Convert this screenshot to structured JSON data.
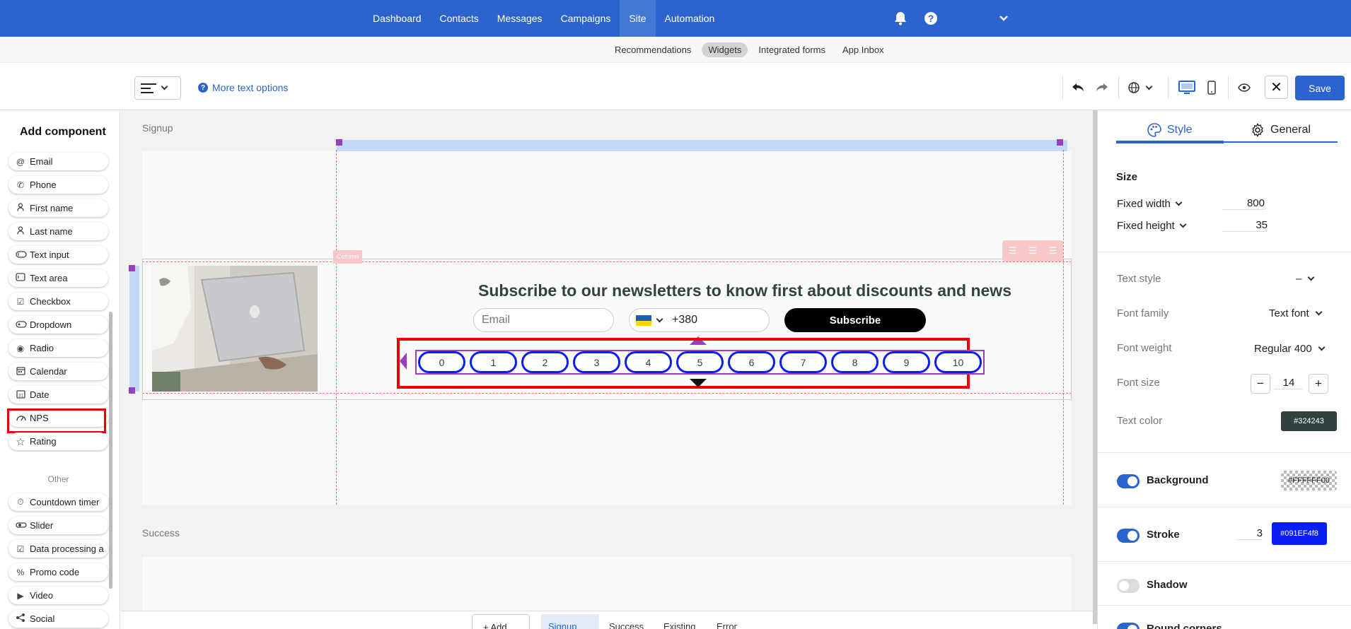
{
  "topnav": {
    "items": [
      "Dashboard",
      "Contacts",
      "Messages",
      "Campaigns",
      "Site",
      "Automation"
    ],
    "active": "Site"
  },
  "subtabs": {
    "items": [
      "Recommendations",
      "Widgets",
      "Integrated forms",
      "App Inbox"
    ],
    "active": "Widgets"
  },
  "toolbar": {
    "more_text_options": "More text options",
    "save_label": "Save"
  },
  "left_panel": {
    "title": "Add component",
    "components": [
      {
        "label": "Email",
        "icon": "at-icon"
      },
      {
        "label": "Phone",
        "icon": "phone-icon"
      },
      {
        "label": "First name",
        "icon": "person-icon"
      },
      {
        "label": "Last name",
        "icon": "person-icon"
      },
      {
        "label": "Text input",
        "icon": "text-input-icon"
      },
      {
        "label": "Text area",
        "icon": "text-area-icon"
      },
      {
        "label": "Checkbox",
        "icon": "checkbox-icon"
      },
      {
        "label": "Dropdown",
        "icon": "dropdown-icon"
      },
      {
        "label": "Radio",
        "icon": "radio-icon"
      },
      {
        "label": "Calendar",
        "icon": "calendar-icon"
      },
      {
        "label": "Date",
        "icon": "date-icon"
      },
      {
        "label": "NPS",
        "icon": "gauge-icon"
      },
      {
        "label": "Rating",
        "icon": "star-icon"
      }
    ],
    "other_heading": "Other",
    "other_components": [
      {
        "label": "Countdown timer",
        "icon": "timer-icon"
      },
      {
        "label": "Slider",
        "icon": "slider-icon"
      },
      {
        "label": "Data processing a",
        "icon": "checkbox-icon"
      },
      {
        "label": "Promo code",
        "icon": "percent-icon"
      },
      {
        "label": "Video",
        "icon": "play-icon"
      },
      {
        "label": "Social",
        "icon": "share-icon"
      }
    ]
  },
  "canvas": {
    "signup_label": "Signup",
    "success_label": "Success",
    "column_tag": "Column",
    "headline": "Subscribe to our newsletters to know first about discounts and news",
    "email_placeholder": "Email",
    "phone_code": "+380",
    "subscribe_label": "Subscribe",
    "nps_values": [
      "0",
      "1",
      "2",
      "3",
      "4",
      "5",
      "6",
      "7",
      "8",
      "9",
      "10"
    ],
    "bottom_tabs": {
      "add": "+ Add",
      "items": [
        "Signup",
        "Success",
        "Existing",
        "Error"
      ]
    }
  },
  "right_panel": {
    "tabs": [
      "Style",
      "General"
    ],
    "active_tab": "Style",
    "size_heading": "Size",
    "fixed_width_label": "Fixed width",
    "fixed_width_value": "800",
    "fixed_height_label": "Fixed height",
    "fixed_height_value": "35",
    "text_style_label": "Text style",
    "text_style_value": "–",
    "font_family_label": "Font family",
    "font_family_value": "Text font",
    "font_weight_label": "Font weight",
    "font_weight_value": "Regular 400",
    "font_size_label": "Font size",
    "font_size_value": "14",
    "text_color_label": "Text color",
    "text_color_value": "#324243",
    "background_label": "Background",
    "background_value": "#FFFFFF00",
    "stroke_label": "Stroke",
    "stroke_width": "3",
    "stroke_color": "#091EF4f8",
    "shadow_label": "Shadow",
    "round_corners_label": "Round corners"
  },
  "colors": {
    "brand": "#2b64ce",
    "nps_stroke": "#091EF4",
    "text": "#324243",
    "selection": "#e00000"
  }
}
